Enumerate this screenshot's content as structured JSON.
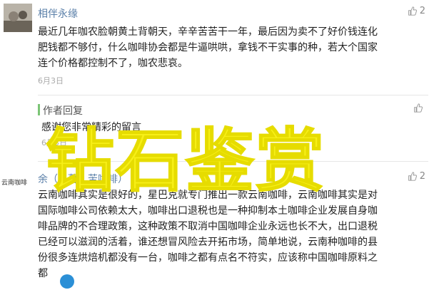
{
  "comments": [
    {
      "user": "相伴永缘",
      "likes": "2",
      "lines": [
        "最近几年咖农脸朝黄土背朝天，辛辛苦苦干一年，最后因为卖不了好价钱连化",
        "肥钱都不够付，什么咖啡协会都是牛逼哄哄，拿钱不干实事的种，若大个国家",
        "连个价格都控制不了，咖农悲哀。"
      ],
      "date": "6月3日"
    },
    {
      "user": "作者回复",
      "likes": "",
      "lines": [
        "感谢您非常精彩的留言"
      ],
      "date": "6月3日"
    },
    {
      "user": "余（日暮，苦咖啡）",
      "logo_text": "云南咖啡",
      "likes": "2",
      "lines": [
        "云南咖啡其实是很好的，星巴克就专门推出一款云南咖啡，云南咖啡其实是对",
        "国际咖啡公司依赖太大，咖啡出口退税也是一种抑制本土咖啡企业发展自身咖",
        "啡品牌的不合理政策，这种政策不取消中国咖啡企业永远也长不大，出口退税",
        "已经可以滋润的活着，谁还想冒风险去开拓市场，简单地说，云南种咖啡的县",
        "份很多连烘焙机都没有一台，咖啡之都有点名不符实，应该称中国咖啡原料之",
        "都"
      ]
    }
  ],
  "overlay_text": "钻石鉴赏"
}
